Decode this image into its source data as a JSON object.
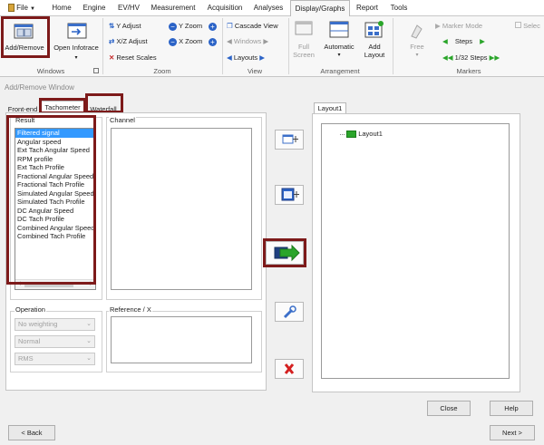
{
  "menu": {
    "file": "File",
    "items": [
      "Home",
      "Engine",
      "EV/HV",
      "Measurement",
      "Acquisition",
      "Analyses",
      "Display/Graphs",
      "Report",
      "Tools"
    ],
    "active_index": 6
  },
  "ribbon": {
    "windows": {
      "group_label": "Windows",
      "add_remove": "Add/Remove",
      "open_infotrace": "Open Infotrace"
    },
    "zoom": {
      "group_label": "Zoom",
      "y_adjust": "Y Adjust",
      "xz_adjust": "X/Z Adjust",
      "reset_scales": "Reset Scales",
      "y_zoom": "Y Zoom",
      "x_zoom": "X Zoom"
    },
    "view": {
      "group_label": "View",
      "cascade_view": "Cascade View",
      "windows": "Windows",
      "layouts": "Layouts"
    },
    "arrangement": {
      "group_label": "Arrangement",
      "full_screen_line1": "Full",
      "full_screen_line2": "Screen",
      "automatic": "Automatic",
      "add_layout_line1": "Add",
      "add_layout_line2": "Layout"
    },
    "markers": {
      "group_label": "Markers",
      "free": "Free",
      "marker_mode": "Marker Mode",
      "steps": "Steps",
      "steps_fraction": "1/32 Steps",
      "select": "Selec"
    }
  },
  "window_title": "Add/Remove Window",
  "tabs": [
    "Front-end",
    "Tachometer",
    "Waterfall"
  ],
  "selected_tab": 1,
  "result": {
    "label": "Result",
    "items": [
      "Filtered signal",
      "Angular speed",
      "Ext Tach Angular Speed",
      "RPM profile",
      "Ext Tach Profile",
      "Fractional Angular Speed",
      "Fractional Tach Profile",
      "Simulated Angular Speed",
      "Simulated Tach Profile",
      "DC Angular Speed",
      "DC Tach Profile",
      "Combined Angular Speed",
      "Combined Tach Profile"
    ],
    "selected_index": 0
  },
  "channel": {
    "label": "Channel"
  },
  "operation": {
    "label": "Operation",
    "weighting": "No weighting",
    "mode": "Normal",
    "stat": "RMS"
  },
  "reference": {
    "label": "Reference / X"
  },
  "layout_tab": "Layout1",
  "layout_tree": {
    "root": "Layout1"
  },
  "buttons": {
    "close": "Close",
    "help": "Help",
    "back": "< Back",
    "next": "Next >"
  },
  "colors": {
    "highlight": "#7d1a1a",
    "selection": "#3399ff",
    "accent_green": "#2aa52a",
    "accent_blue": "#2b63c7"
  }
}
